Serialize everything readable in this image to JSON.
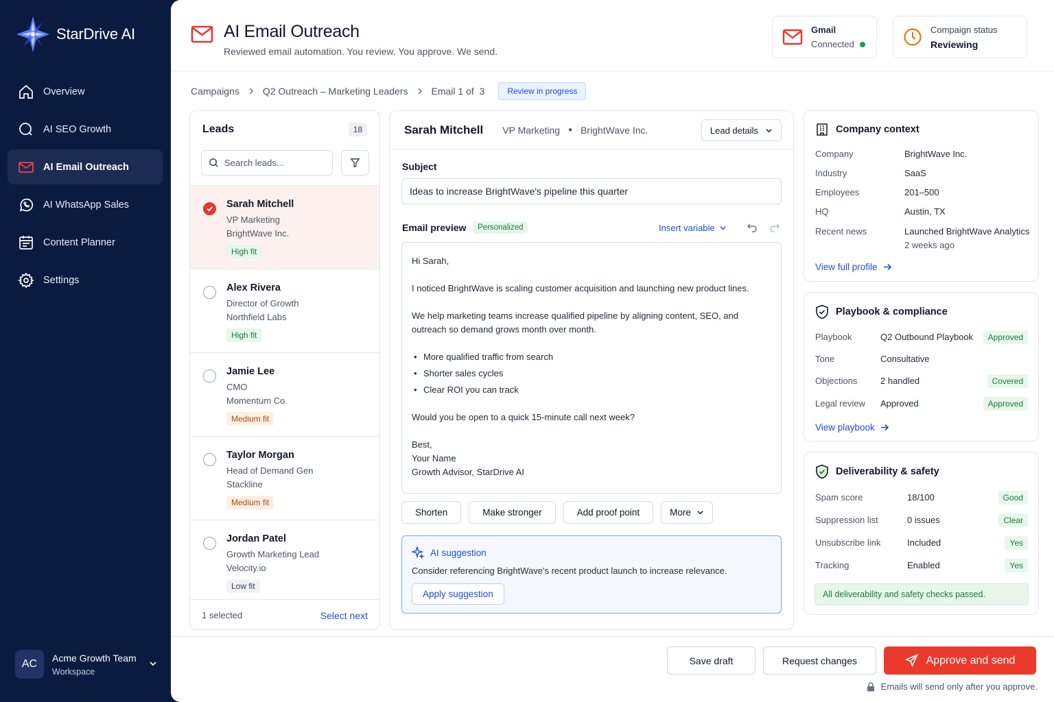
{
  "app": {
    "name": "StarDrive AI"
  },
  "sidebar": {
    "items": [
      {
        "label": "Overview",
        "icon": "home-icon"
      },
      {
        "label": "AI SEO Growth",
        "icon": "search-icon"
      },
      {
        "label": "AI Email Outreach",
        "icon": "mail-icon",
        "active": true
      },
      {
        "label": "AI WhatsApp Sales",
        "icon": "whatsapp-icon"
      },
      {
        "label": "Content Planner",
        "icon": "calendar-icon"
      },
      {
        "label": "Settings",
        "icon": "gear-icon"
      }
    ],
    "workspace": {
      "initials": "AC",
      "name": "Acme Growth Team",
      "type": "Workspace"
    }
  },
  "header": {
    "title": "AI Email Outreach",
    "subtitle": "Reviewed email automation. You review. You approve. We send.",
    "gmail": {
      "label": "Gmail",
      "status": "Connected",
      "status_color": "#16a34a"
    },
    "campaign": {
      "label": "Compaign status",
      "status": "Reviewing"
    }
  },
  "breadcrumb": {
    "items": [
      "Campaigns",
      "Q2 Outreach – Marketing Leaders"
    ],
    "email_position": "Email 1 of  3",
    "badge": "Review in progress"
  },
  "leads": {
    "title": "Leads",
    "count": "18",
    "search_placeholder": "Search leads...",
    "items": [
      {
        "name": "Sarah Mitchell",
        "role": "VP Marketing",
        "company": "BrightWave Inc.",
        "fit": "High fit",
        "selected": true
      },
      {
        "name": "Alex Rivera",
        "role": "Director of Growth",
        "company": "Northfield Labs",
        "fit": "High fit"
      },
      {
        "name": "Jamie Lee",
        "role": "CMO",
        "company": "Momentum Co.",
        "fit": "Medium fit"
      },
      {
        "name": "Taylor Morgan",
        "role": "Head of Demand Gen",
        "company": "Stackline",
        "fit": "Medium fit"
      },
      {
        "name": "Jordan Patel",
        "role": "Growth Marketing Lead",
        "company": "Velocity.io",
        "fit": "Low fit"
      }
    ],
    "footer_selected": "1 selected",
    "footer_next": "Select next"
  },
  "editor": {
    "lead_name": "Sarah Mitchell",
    "lead_role": "VP Marketing",
    "lead_company": "BrightWave Inc.",
    "lead_details_btn": "Lead details",
    "subject_label": "Subject",
    "subject_value": "Ideas to increase BrightWave's pipeline this quarter",
    "preview_label": "Email preview",
    "personalized_badge": "Personalized",
    "insert_variable": "Insert variable",
    "body": {
      "greeting": "Hi Sarah,",
      "p1": "I noticed BrightWave is scaling customer acquisition and launching new product lines.",
      "p2": "We help marketing teams increase qualified pipeline by aligning content, SEO, and outreach so demand grows month over month.",
      "bullets": [
        "More qualified traffic from search",
        "Shorter sales cycles",
        "Clear ROI you can track"
      ],
      "p3": "Would you be open to a quick 15-minute call next week?",
      "signoff": "Best,",
      "sig_name": "Your Name",
      "sig_title": "Growth Advisor, StarDrive AI"
    },
    "actions": [
      "Shorten",
      "Make stronger",
      "Add proof point",
      "More"
    ],
    "ai_suggestion": {
      "title": "AI suggestion",
      "text": "Consider referencing BrightWave's recent product launch to increase relevance.",
      "button": "Apply suggestion"
    }
  },
  "company_context": {
    "title": "Company context",
    "rows": [
      {
        "key": "Company",
        "value": "BrightWave Inc."
      },
      {
        "key": "Industry",
        "value": "SaaS"
      },
      {
        "key": "Employees",
        "value": "201–500"
      },
      {
        "key": "HQ",
        "value": "Austin, TX"
      },
      {
        "key": "Recent news",
        "value": "Launched BrightWave Analytics",
        "sub": "2 weeks ago"
      }
    ],
    "link": "View full profile"
  },
  "playbook": {
    "title": "Playbook & compliance",
    "rows": [
      {
        "key": "Playbook",
        "value": "Q2 Outbound Playbook",
        "pill": "Approved"
      },
      {
        "key": "Tone",
        "value": "Consultative",
        "pill": ""
      },
      {
        "key": "Objections",
        "value": "2 handled",
        "pill": "Covered"
      },
      {
        "key": "Legal review",
        "value": "Approved",
        "pill": "Approved"
      }
    ],
    "link": "View playbook"
  },
  "deliverability": {
    "title": "Deliverability & safety",
    "rows": [
      {
        "key": "Spam score",
        "value": "18/100",
        "pill": "Good"
      },
      {
        "key": "Suppression list",
        "value": "0 issues",
        "pill": "Clear"
      },
      {
        "key": "Unsubscribe link",
        "value": "Included",
        "pill": "Yes"
      },
      {
        "key": "Tracking",
        "value": "Enabled",
        "pill": "Yes"
      }
    ],
    "passed": "All deliverability and safety checks passed."
  },
  "footer": {
    "save_draft": "Save draft",
    "request_changes": "Request changes",
    "approve": "Approve and send",
    "note": "Emails will send only after you approve."
  },
  "colors": {
    "brand_red": "#ea3a2c",
    "navy": "#0b1a3f",
    "link_blue": "#1d4ed8",
    "success": "#15803d"
  }
}
